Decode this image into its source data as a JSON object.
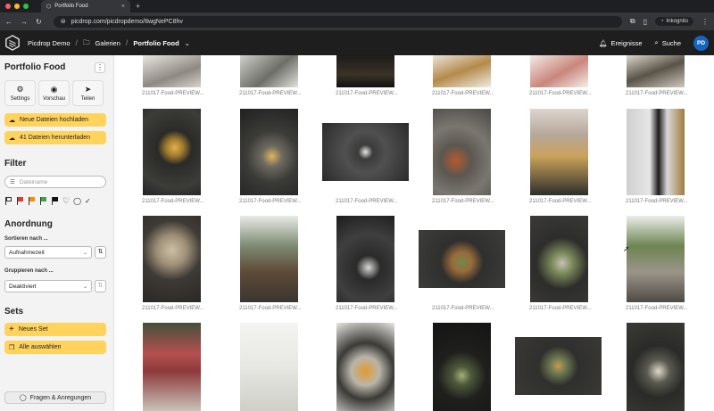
{
  "browser": {
    "tab_title": "Portfolio Food",
    "new_tab": "+",
    "url": "picdrop.com/picdropdemo/8wgNePC8hv",
    "incognito": "Inkognito"
  },
  "appbar": {
    "workspace": "Picdrop Demo",
    "galleries": "Galerien",
    "current": "Portfolio Food",
    "events": "Ereignisse",
    "search": "Suche",
    "avatar": "PD"
  },
  "sidebar": {
    "title": "Portfolio Food",
    "tools": [
      {
        "label": "Settings",
        "icon": "gear-icon"
      },
      {
        "label": "Vorschau",
        "icon": "eye-icon"
      },
      {
        "label": "Teilen",
        "icon": "send-icon"
      }
    ],
    "upload": "Neue Dateien hochladen",
    "download": "41 Dateien herunterladen",
    "filter_heading": "Filter",
    "filter_placeholder": "Dateiname",
    "order_heading": "Anordnung",
    "sort_label": "Sortieren nach ...",
    "sort_value": "Aufnahmezeit",
    "group_label": "Gruppieren nach ...",
    "group_value": "Deaktiviert",
    "sets_heading": "Sets",
    "new_set": "Neues Set",
    "select_all": "Alle auswählen",
    "feedback": "Fragen & Anregungen"
  },
  "colors": {
    "accent": "#ffd35c",
    "avatar": "#1565c0",
    "flag_red": "#e53935",
    "flag_orange": "#fb8c00",
    "flag_green": "#43a047",
    "flag_black": "#111111"
  },
  "gallery": {
    "caption": "211017-Food-PREVIEW...",
    "items": [
      {
        "caption": "211017-Food-PREVIEW..."
      },
      {
        "caption": "211017-Food-PREVIEW..."
      },
      {
        "caption": "211017-Food-PREVIEW..."
      },
      {
        "caption": "211017-Food-PREVIEW..."
      },
      {
        "caption": "211017-Food-PREVIEW..."
      },
      {
        "caption": "211017-Food-PREVIEW..."
      },
      {
        "caption": "211017-Food-PREVIEW..."
      },
      {
        "caption": "211017-Food-PREVIEW..."
      },
      {
        "caption": "211017-Food-PREVIEW..."
      },
      {
        "caption": "211017-Food-PREVIEW..."
      },
      {
        "caption": "211017-Food-PREVIEW..."
      },
      {
        "caption": "211017-Food-PREVIEW..."
      },
      {
        "caption": "211017-Food-PREVIEW..."
      },
      {
        "caption": "211017-Food-PREVIEW..."
      },
      {
        "caption": "211017-Food-PREVIEW..."
      },
      {
        "caption": "211017-Food-PREVIEW..."
      },
      {
        "caption": "211017-Food-PREVIEW..."
      },
      {
        "caption": "211017-Food-PREVIEW..."
      }
    ]
  }
}
